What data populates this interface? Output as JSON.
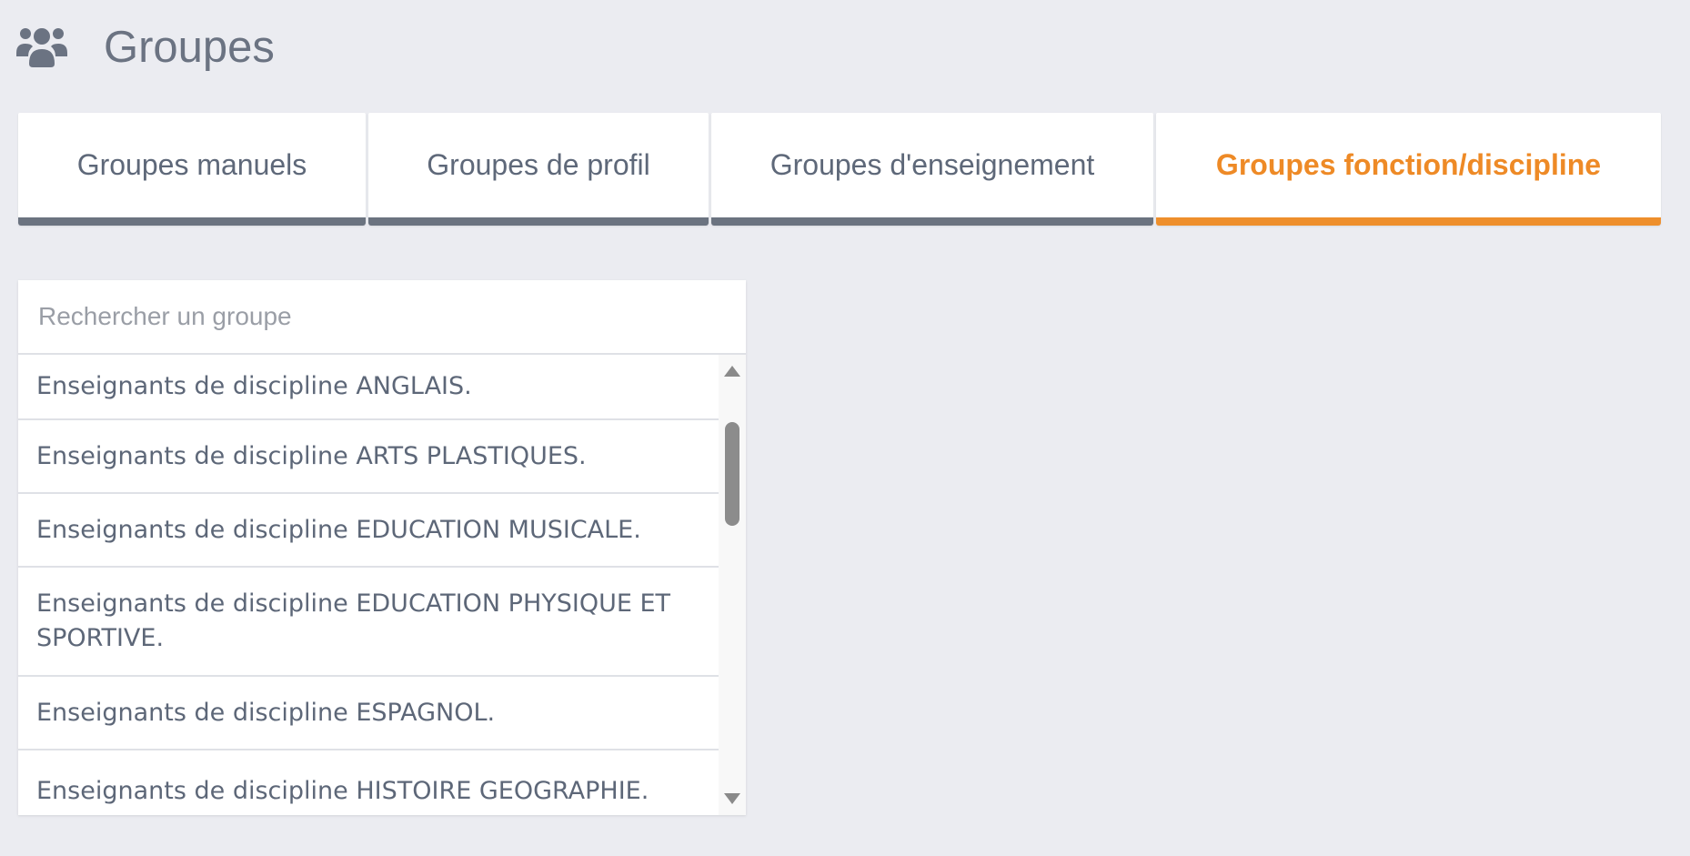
{
  "header": {
    "icon": "users-icon",
    "title": "Groupes"
  },
  "tabs": [
    {
      "label": "Groupes manuels",
      "active": false
    },
    {
      "label": "Groupes de profil",
      "active": false
    },
    {
      "label": "Groupes d'enseignement",
      "active": false
    },
    {
      "label": "Groupes fonction/discipline",
      "active": true
    }
  ],
  "colors": {
    "accent": "#ee8a26",
    "tab_underline": "#6b7380",
    "background": "#ebecf1",
    "text": "#5d6778"
  },
  "search": {
    "placeholder": "Rechercher un groupe",
    "value": ""
  },
  "groups": [
    "Enseignants de discipline ANGLAIS.",
    "Enseignants de discipline ARTS PLASTIQUES.",
    "Enseignants de discipline EDUCATION MUSICALE.",
    "Enseignants de discipline EDUCATION PHYSIQUE ET SPORTIVE.",
    "Enseignants de discipline ESPAGNOL.",
    "Enseignants de discipline HISTOIRE GEOGRAPHIE."
  ],
  "scrollbar": {
    "up_icon": "triangle-up-icon",
    "down_icon": "triangle-down-icon"
  }
}
